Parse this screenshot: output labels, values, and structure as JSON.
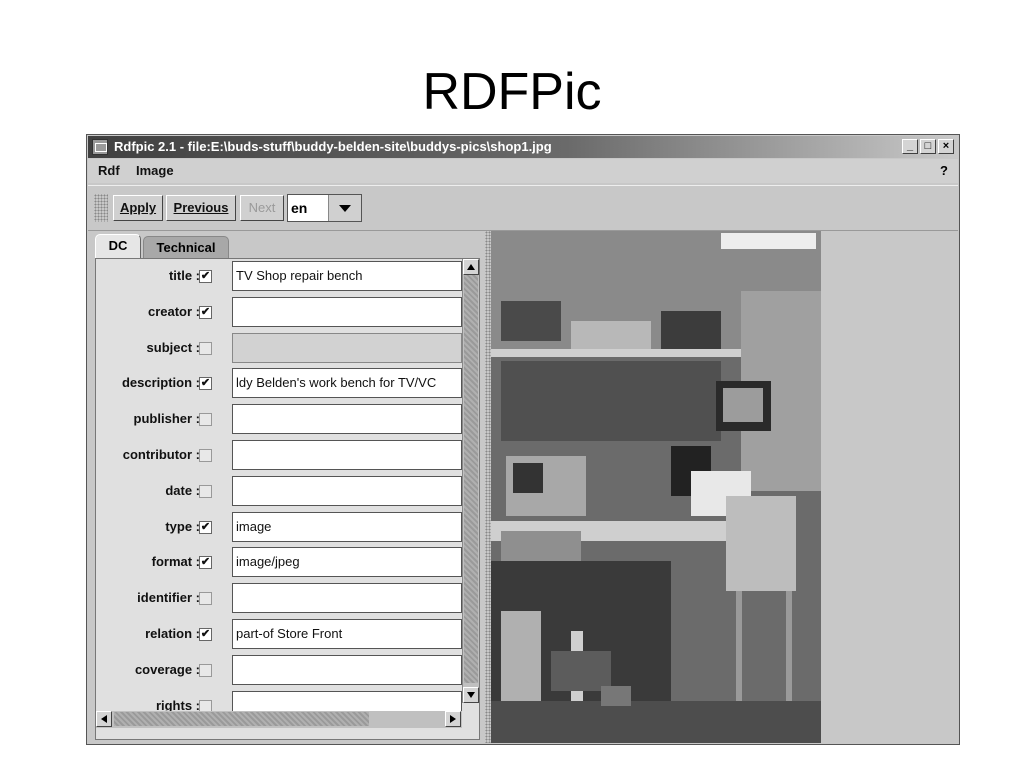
{
  "slide": {
    "title": "RDFPic"
  },
  "window": {
    "title": "Rdfpic 2.1 - file:E:\\buds-stuff\\buddy-belden-site\\buddys-pics\\shop1.jpg",
    "controls": {
      "minimize": "_",
      "maximize": "□",
      "close": "×"
    }
  },
  "menu": {
    "items": [
      "Rdf",
      "Image"
    ],
    "help": "?"
  },
  "toolbar": {
    "apply": "Apply",
    "previous": "Previous",
    "next": "Next",
    "language": "en"
  },
  "tabs": [
    "DC",
    "Technical"
  ],
  "fields": [
    {
      "label": "title :",
      "checked": true,
      "value": "TV Shop repair bench",
      "enabled": true
    },
    {
      "label": "creator :",
      "checked": true,
      "value": "",
      "enabled": true
    },
    {
      "label": "subject :",
      "checked": false,
      "value": "",
      "enabled": false
    },
    {
      "label": "description :",
      "checked": true,
      "value": "ldy Belden's work bench for TV/VC",
      "enabled": true
    },
    {
      "label": "publisher :",
      "checked": false,
      "value": "",
      "enabled": true
    },
    {
      "label": "contributor :",
      "checked": false,
      "value": "",
      "enabled": true
    },
    {
      "label": "date :",
      "checked": false,
      "value": "",
      "enabled": true
    },
    {
      "label": "type :",
      "checked": true,
      "value": "image",
      "enabled": true
    },
    {
      "label": "format :",
      "checked": true,
      "value": "image/jpeg",
      "enabled": true
    },
    {
      "label": "identifier :",
      "checked": false,
      "value": "",
      "enabled": true
    },
    {
      "label": "relation :",
      "checked": true,
      "value": "part-of Store Front",
      "enabled": true
    },
    {
      "label": "coverage :",
      "checked": false,
      "value": "",
      "enabled": true
    },
    {
      "label": "rights :",
      "checked": false,
      "value": "",
      "enabled": true
    }
  ],
  "check_mark": "✔"
}
